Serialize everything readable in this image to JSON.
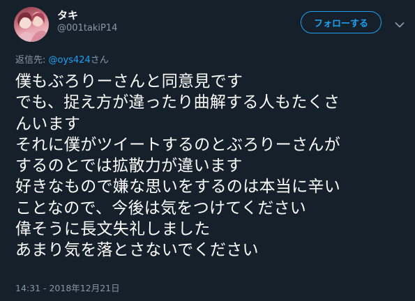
{
  "author": {
    "display_name": "タキ",
    "handle": "@001takiP14"
  },
  "follow_button_label": "フォローする",
  "reply_context": {
    "prefix": "返信先: ",
    "mention": "@oys424",
    "suffix": "さん"
  },
  "tweet": {
    "lines": [
      "僕もぶろりーさんと同意見です",
      "でも、捉え方が違ったり曲解する人もたくさ",
      "んいます",
      "それに僕がツイートするのとぶろりーさんが",
      "するのとでは拡散力が違います",
      "好きなもので嫌な思いをするのは本当に辛い",
      "ことなので、今後は気をつけてください",
      "偉そうに長文失礼しました",
      "あまり気を落とさないでください"
    ]
  },
  "timestamp": "14:31 - 2018年12月21日",
  "colors": {
    "background": "#15202b",
    "text": "#ffffff",
    "secondary_text": "#8899a6",
    "accent": "#1da1f2"
  }
}
